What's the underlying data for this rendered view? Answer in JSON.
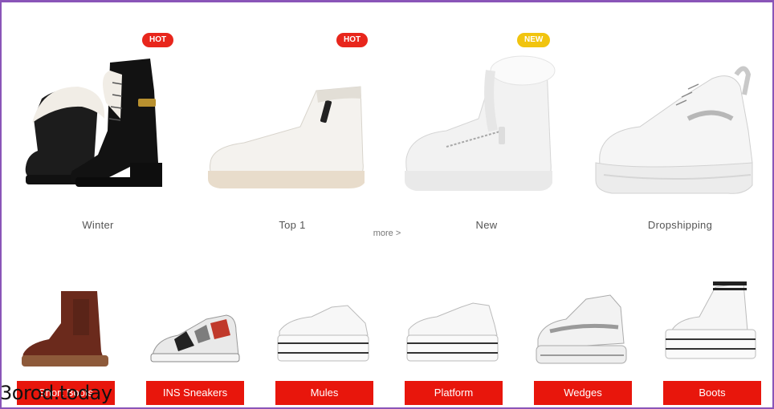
{
  "categories": [
    {
      "label": "Winter",
      "badge": "HOT",
      "badge_color": "#e8261c"
    },
    {
      "label": "Top 1",
      "badge": "HOT",
      "badge_color": "#e8261c"
    },
    {
      "label": "New",
      "badge": "NEW",
      "badge_color": "#f1c40f"
    },
    {
      "label": "Dropshipping",
      "badge": "",
      "badge_color": ""
    }
  ],
  "more_link": "more >",
  "subcategories": [
    {
      "label": "Short Boots"
    },
    {
      "label": "INS Sneakers"
    },
    {
      "label": "Mules"
    },
    {
      "label": "Platform"
    },
    {
      "label": "Wedges"
    },
    {
      "label": "Boots"
    }
  ],
  "watermark": "3orod.today",
  "colors": {
    "accent": "#e8160c",
    "hot": "#e8261c",
    "new": "#f1c40f",
    "frame": "#8a55b8"
  }
}
